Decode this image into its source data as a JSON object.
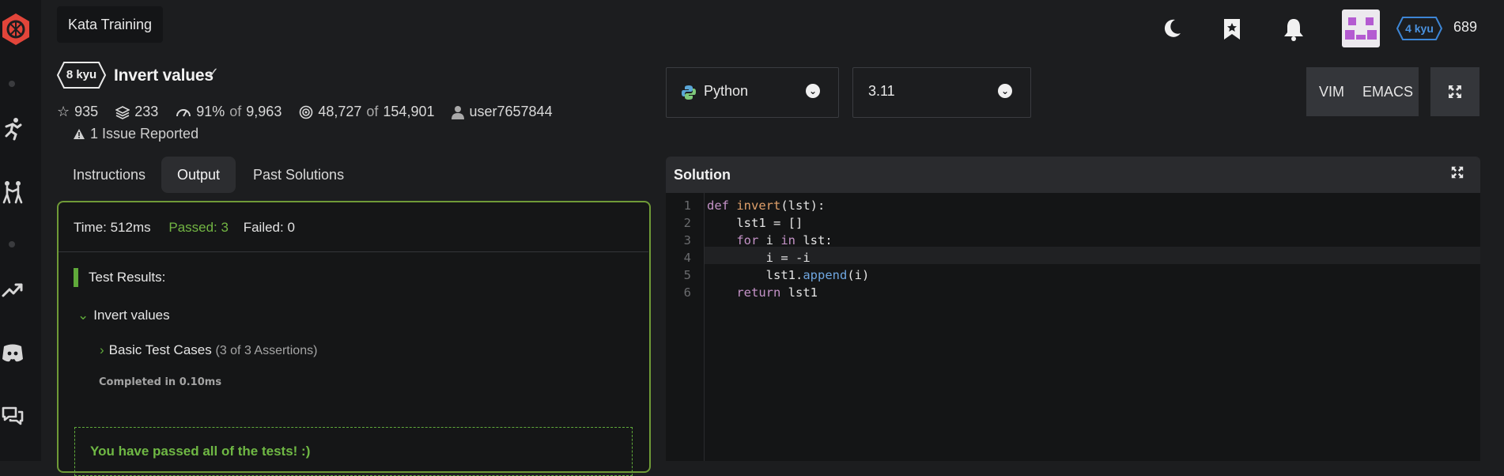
{
  "app": {
    "tooltip": "Kata Training"
  },
  "header": {
    "icons": [
      "moon-icon",
      "bookmark-icon",
      "bell-icon"
    ],
    "rank": "4 kyu",
    "honor": "689"
  },
  "rail": {
    "icons": [
      "codewars-logo",
      "dot",
      "running-icon",
      "fighting-icon",
      "dot",
      "trending-icon",
      "discord-icon",
      "chat-icon"
    ]
  },
  "kata": {
    "kyu": "8 kyu",
    "title": "Invert values",
    "stats": {
      "stars": "935",
      "collections": "233",
      "satisfaction": "91%",
      "satisfaction_of": "of",
      "votes": "9,963",
      "completed": "48,727",
      "completed_of": "of",
      "attempts": "154,901",
      "author": "user7657844"
    },
    "issue": "1 Issue Reported"
  },
  "tabs": [
    {
      "label": "Instructions",
      "active": false
    },
    {
      "label": "Output",
      "active": true
    },
    {
      "label": "Past Solutions",
      "active": false
    }
  ],
  "output": {
    "time": "Time: 512ms",
    "passed": "Passed: 3",
    "failed": "Failed: 0",
    "test_results_label": "Test Results:",
    "suite": "Invert values",
    "case": "Basic Test Cases",
    "assertions": "(3 of 3 Assertions)",
    "completed": "Completed in 0.10ms",
    "pass_message": "You have passed all of the tests! :)"
  },
  "selectors": {
    "language": "Python",
    "version": "3.11"
  },
  "modes": {
    "vim": "VIM",
    "emacs": "EMACS"
  },
  "editor": {
    "title": "Solution",
    "current_line": 4,
    "lines": [
      {
        "n": "1",
        "indent": "",
        "parts": [
          [
            "kw",
            "def"
          ],
          [
            "t",
            " "
          ],
          [
            "fn",
            "invert"
          ],
          [
            "t",
            "(lst):"
          ]
        ]
      },
      {
        "n": "2",
        "indent": "    ",
        "parts": [
          [
            "t",
            "lst1 = []"
          ]
        ]
      },
      {
        "n": "3",
        "indent": "    ",
        "parts": [
          [
            "kw",
            "for"
          ],
          [
            "t",
            " i "
          ],
          [
            "kw",
            "in"
          ],
          [
            "t",
            " lst:"
          ]
        ]
      },
      {
        "n": "4",
        "indent": "        ",
        "parts": [
          [
            "t",
            "i = -i"
          ]
        ]
      },
      {
        "n": "5",
        "indent": "        ",
        "parts": [
          [
            "t",
            "lst1."
          ],
          [
            "mt",
            "append"
          ],
          [
            "t",
            "(i)"
          ]
        ]
      },
      {
        "n": "6",
        "indent": "    ",
        "parts": [
          [
            "kw",
            "return"
          ],
          [
            "t",
            " lst1"
          ]
        ]
      }
    ]
  },
  "colors": {
    "pass_green": "#72b543",
    "panel_border": "#6f9a37",
    "rank_blue": "#3d86d6",
    "keyword": "#c593c8"
  }
}
